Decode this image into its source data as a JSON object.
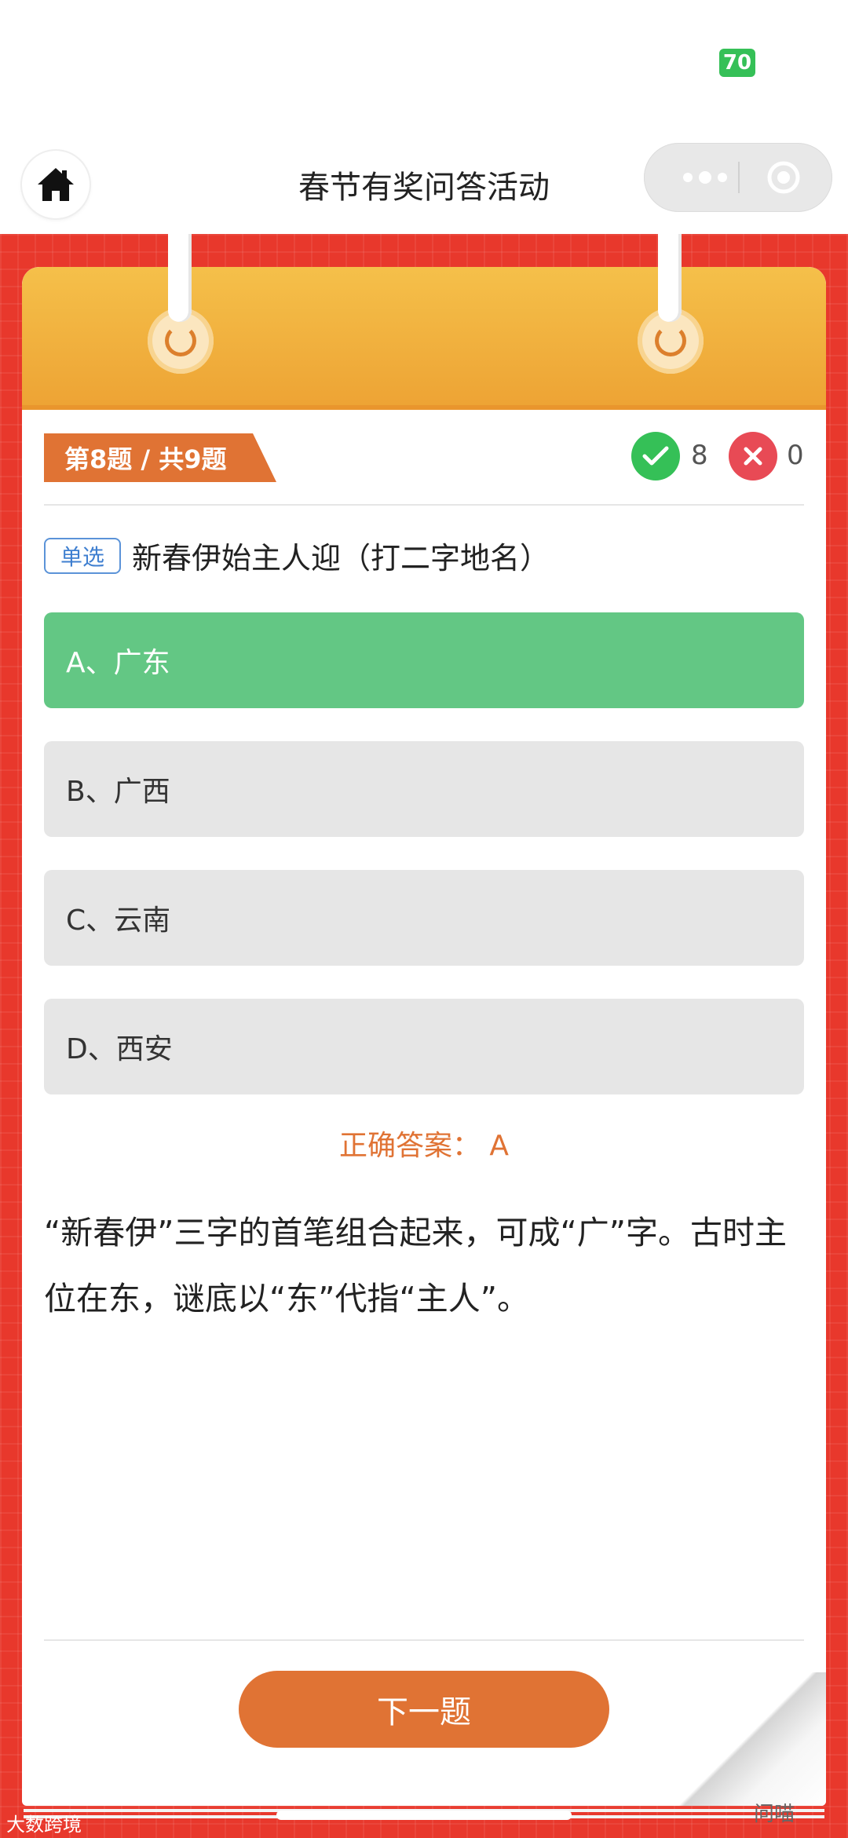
{
  "status_bar": {
    "battery": "70"
  },
  "nav": {
    "title": "春节有奖问答活动",
    "home_icon": "home-icon",
    "more_icon": "more-dots-icon",
    "close_icon": "target-circle-icon"
  },
  "question": {
    "progress_label": "第8题 / 共9题",
    "correct_count": "8",
    "wrong_count": "0",
    "type_label": "单选",
    "text": "新春伊始主人迎（打二字地名）"
  },
  "options": [
    {
      "label": "A、广东",
      "state": "correct"
    },
    {
      "label": "B、广西",
      "state": "normal"
    },
    {
      "label": "C、云南",
      "state": "normal"
    },
    {
      "label": "D、西安",
      "state": "normal"
    }
  ],
  "answer": {
    "label": "正确答案：  A"
  },
  "explanation": "“新春伊”三字的首笔组合起来，可成“广”字。古时主位在东，谜底以“东”代指“主人”。",
  "footer": {
    "next_button": "下一题"
  },
  "watermarks": {
    "left": "大数跨境",
    "right": "问喵"
  },
  "colors": {
    "red_bg": "#e8382c",
    "orange": "#e07334",
    "correct_green": "#63c784",
    "check_green": "#35c057",
    "wrong_red": "#e84a55",
    "tag_blue": "#3f7fd0"
  }
}
